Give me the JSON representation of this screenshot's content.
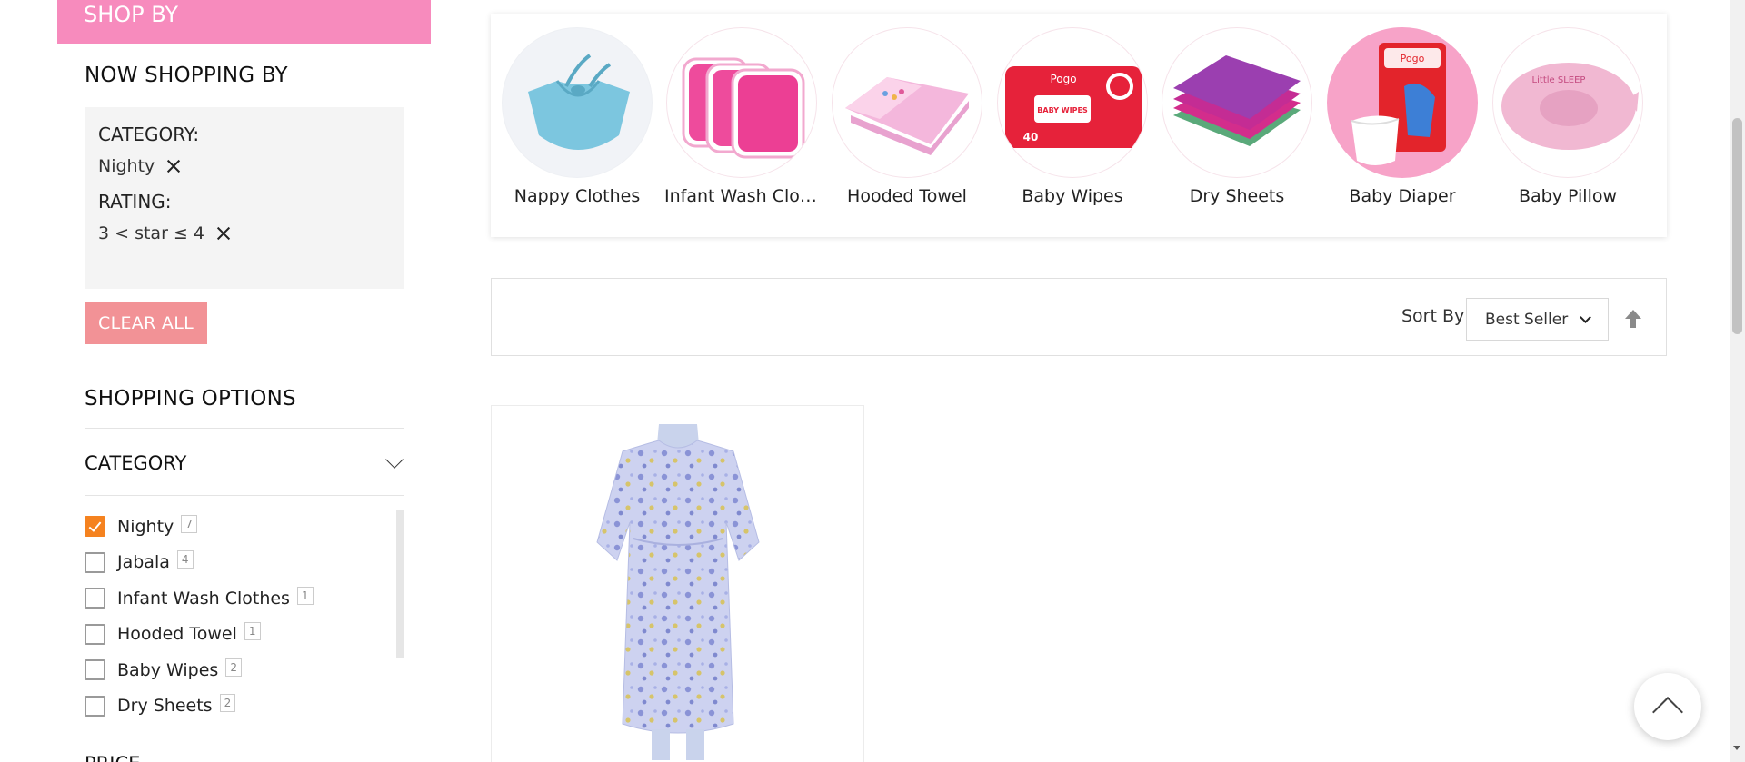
{
  "sidebar": {
    "shop_by_title": "SHOP BY",
    "now_shopping_title": "NOW SHOPPING BY",
    "active_filters": [
      {
        "label": "CATEGORY:",
        "value": "Nighty"
      },
      {
        "label": "RATING:",
        "value": "3 < star ≤ 4"
      }
    ],
    "clear_all_label": "CLEAR ALL",
    "shopping_options_title": "SHOPPING OPTIONS",
    "category_header": "CATEGORY",
    "categories": [
      {
        "label": "Nighty",
        "count": "7",
        "checked": true
      },
      {
        "label": "Jabala",
        "count": "4",
        "checked": false
      },
      {
        "label": "Infant Wash Clothes",
        "count": "1",
        "checked": false
      },
      {
        "label": "Hooded Towel",
        "count": "1",
        "checked": false
      },
      {
        "label": "Baby Wipes",
        "count": "2",
        "checked": false
      },
      {
        "label": "Dry Sheets",
        "count": "2",
        "checked": false
      }
    ],
    "next_section_peek": "PRICE"
  },
  "carousel": {
    "items": [
      {
        "label": "Nappy Clothes",
        "icon": "nappy-clothes-image"
      },
      {
        "label": "Infant Wash Clot...",
        "icon": "infant-wash-clothes-image"
      },
      {
        "label": "Hooded Towel",
        "icon": "hooded-towel-image"
      },
      {
        "label": "Baby Wipes",
        "icon": "baby-wipes-image"
      },
      {
        "label": "Dry Sheets",
        "icon": "dry-sheets-image"
      },
      {
        "label": "Baby Diaper",
        "icon": "baby-diaper-image"
      },
      {
        "label": "Baby Pillow",
        "icon": "baby-pillow-image"
      }
    ],
    "product_text": {
      "wipes_brand": "Pogo",
      "wipes_name": "BABY WIPES",
      "wipes_count": "40",
      "diaper_brand": "Pogo",
      "pillow_text": "Little SLEEP"
    }
  },
  "toolbar": {
    "sort_by_label": "Sort By",
    "sort_selected": "Best Seller",
    "sort_direction_icon": "arrow-up-icon"
  },
  "products": [
    {
      "image": "floral-nighty-dress-image"
    }
  ],
  "colors": {
    "brand_pink": "#f78bbd",
    "clear_all": "#f29296",
    "checkbox_checked": "#f5821f"
  }
}
